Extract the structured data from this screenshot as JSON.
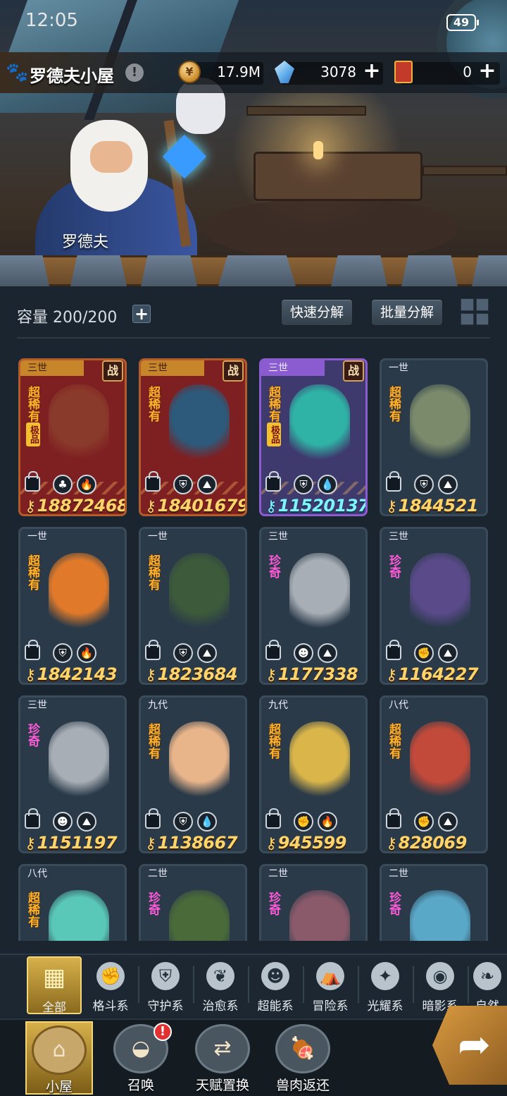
{
  "status": {
    "time": "12:05",
    "battery": "49"
  },
  "header": {
    "title": "罗德夫小屋",
    "npc_name": "罗德夫",
    "resources": [
      {
        "icon": "coin-icon",
        "value": "17.9M"
      },
      {
        "icon": "crystal-icon",
        "value": "3078"
      },
      {
        "icon": "ticket-icon",
        "value": "0"
      }
    ]
  },
  "toolbar": {
    "capacity": "容量 200/200",
    "quick_decompose": "快速分解",
    "batch_decompose": "批量分解"
  },
  "cards": [
    {
      "tier": "三世",
      "rarity": "超稀有",
      "extreme": "极品",
      "battle": "战",
      "style": "red",
      "class_icon": "♣",
      "element_icon": "🔥",
      "power": "18872468"
    },
    {
      "tier": "三世",
      "rarity": "超稀有",
      "extreme": "",
      "battle": "战",
      "style": "red",
      "class_icon": "⛨",
      "element_icon": "⛰",
      "power": "18401679"
    },
    {
      "tier": "三世",
      "rarity": "超稀有",
      "extreme": "极品",
      "battle": "战",
      "style": "purple",
      "class_icon": "⛨",
      "element_icon": "💧",
      "power": "11520137"
    },
    {
      "tier": "一世",
      "rarity": "超稀有",
      "extreme": "",
      "battle": "",
      "style": "blue",
      "class_icon": "⛨",
      "element_icon": "⛰",
      "power": "1844521"
    },
    {
      "tier": "一世",
      "rarity": "超稀有",
      "extreme": "",
      "battle": "",
      "style": "blue",
      "class_icon": "⛨",
      "element_icon": "🔥",
      "power": "1842143"
    },
    {
      "tier": "一世",
      "rarity": "超稀有",
      "extreme": "",
      "battle": "",
      "style": "blue",
      "class_icon": "⛨",
      "element_icon": "⛰",
      "power": "1823684"
    },
    {
      "tier": "三世",
      "rarity": "珍奇",
      "extreme": "",
      "battle": "",
      "style": "blue",
      "class_icon": "☻",
      "element_icon": "⛰",
      "power": "1177338"
    },
    {
      "tier": "三世",
      "rarity": "珍奇",
      "extreme": "",
      "battle": "",
      "style": "blue",
      "class_icon": "✊",
      "element_icon": "⛰",
      "power": "1164227"
    },
    {
      "tier": "三世",
      "rarity": "珍奇",
      "extreme": "",
      "battle": "",
      "style": "blue",
      "class_icon": "☻",
      "element_icon": "⛰",
      "power": "1151197"
    },
    {
      "tier": "九代",
      "rarity": "超稀有",
      "extreme": "",
      "battle": "",
      "style": "blue",
      "class_icon": "⛨",
      "element_icon": "💧",
      "power": "1138667"
    },
    {
      "tier": "九代",
      "rarity": "超稀有",
      "extreme": "",
      "battle": "",
      "style": "blue",
      "class_icon": "✊",
      "element_icon": "🔥",
      "power": "945599"
    },
    {
      "tier": "八代",
      "rarity": "超稀有",
      "extreme": "",
      "battle": "",
      "style": "blue",
      "class_icon": "✊",
      "element_icon": "⛰",
      "power": "828069"
    },
    {
      "tier": "八代",
      "rarity": "超稀有",
      "extreme": "",
      "battle": "",
      "style": "blue",
      "class_icon": "",
      "element_icon": "",
      "power": ""
    },
    {
      "tier": "二世",
      "rarity": "珍奇",
      "extreme": "",
      "battle": "",
      "style": "blue",
      "class_icon": "",
      "element_icon": "",
      "power": ""
    },
    {
      "tier": "二世",
      "rarity": "珍奇",
      "extreme": "",
      "battle": "",
      "style": "blue",
      "class_icon": "",
      "element_icon": "",
      "power": ""
    },
    {
      "tier": "二世",
      "rarity": "珍奇",
      "extreme": "",
      "battle": "",
      "style": "blue",
      "class_icon": "",
      "element_icon": "",
      "power": ""
    }
  ],
  "tabs": [
    {
      "label": "全部",
      "icon": "all-icon",
      "active": true
    },
    {
      "label": "格斗系",
      "icon": "fist-icon"
    },
    {
      "label": "守护系",
      "icon": "shield-icon"
    },
    {
      "label": "治愈系",
      "icon": "sprout-icon"
    },
    {
      "label": "超能系",
      "icon": "alien-icon"
    },
    {
      "label": "冒险系",
      "icon": "adventure-icon"
    },
    {
      "label": "光耀系",
      "icon": "star-icon"
    },
    {
      "label": "暗影系",
      "icon": "eye-icon"
    },
    {
      "label": "自然",
      "icon": "leaf-icon"
    }
  ],
  "nav": [
    {
      "label": "小屋",
      "icon": "house-icon",
      "active": true
    },
    {
      "label": "召唤",
      "icon": "egg-icon",
      "alert": "!"
    },
    {
      "label": "天赋置换",
      "icon": "swap-icon"
    },
    {
      "label": "兽肉返还",
      "icon": "meat-icon"
    }
  ],
  "colors": {
    "power_gold": "#ffd46a",
    "power_cyan": "#7ff4ff",
    "ur": "#ffb12a",
    "sr": "#ff5ad9",
    "active_tab": "#d7b04a"
  }
}
